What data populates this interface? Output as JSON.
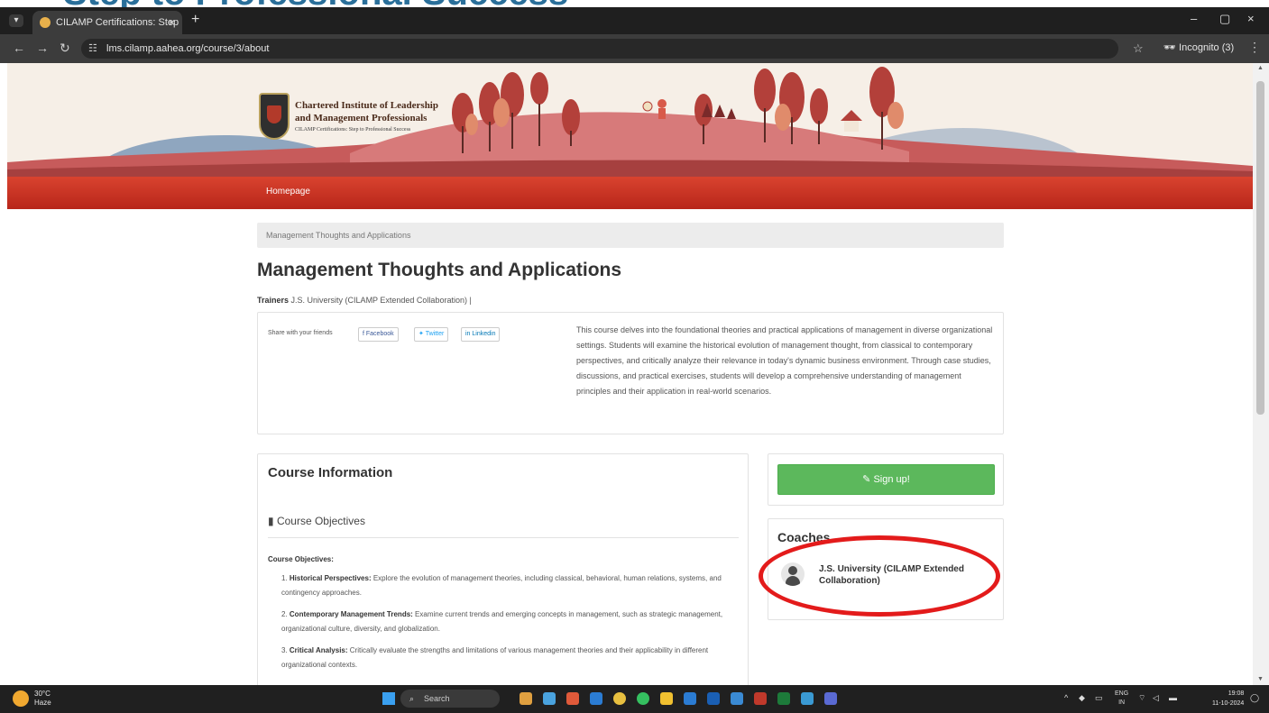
{
  "overlay_heading": "Step to Professional Success",
  "browser": {
    "tab_title": "CILAMP Certifications: Step to P",
    "tab_close": "×",
    "new_tab": "+",
    "url": "lms.cilamp.aahea.org/course/3/about",
    "profile": "Incognito (3)",
    "win_min": "–",
    "win_max": "▢",
    "win_close": "×"
  },
  "banner": {
    "org_line1": "Chartered Institute of Leadership",
    "org_line2": "and Management Professionals",
    "tagline": "CILAMP Certifications: Step to Professional Success"
  },
  "nav": {
    "home": "Homepage"
  },
  "breadcrumb": "Management Thoughts and Applications",
  "course": {
    "title": "Management Thoughts and Applications",
    "trainers_label": "Trainers",
    "trainers_value": "J.S. University (CILAMP Extended Collaboration) |",
    "share_label": "Share with your friends",
    "share_facebook": "Facebook",
    "share_twitter": "Twitter",
    "share_linkedin": "Linkedin",
    "description": "This course delves into the foundational theories and practical applications of management in diverse organizational settings. Students will examine the historical evolution of management thought, from classical to contemporary perspectives, and critically analyze their relevance in today's dynamic business environment. Through case studies, discussions, and practical exercises, students will develop a comprehensive understanding of management principles and their application in real-world scenarios.",
    "info_heading": "Course Information",
    "objectives_heading": "Course Objectives",
    "objectives_sub": "Course Objectives:",
    "objectives": [
      {
        "num": "1.",
        "title": "Historical Perspectives:",
        "text": " Explore the evolution of management theories, including classical, behavioral, human relations, systems, and contingency approaches."
      },
      {
        "num": "2.",
        "title": "Contemporary Management Trends:",
        "text": " Examine current trends and emerging concepts in management, such as strategic management, organizational culture, diversity, and globalization."
      },
      {
        "num": "3.",
        "title": "Critical Analysis:",
        "text": " Critically evaluate the strengths and limitations of various management theories and their applicability in different organizational contexts."
      }
    ]
  },
  "sidebar": {
    "signup": "Sign up!",
    "coaches_heading": "Coaches",
    "coach_name": "J.S. University (CILAMP Extended Collaboration)"
  },
  "taskbar": {
    "temp": "30°C",
    "weather": "Haze",
    "search": "Search",
    "lang1": "ENG",
    "lang2": "IN",
    "time": "19:08",
    "date": "11-10-2024"
  },
  "colors": {
    "accent_red": "#c8321f",
    "signup_green": "#5cb85c",
    "annotation_red": "#e31b1b"
  }
}
